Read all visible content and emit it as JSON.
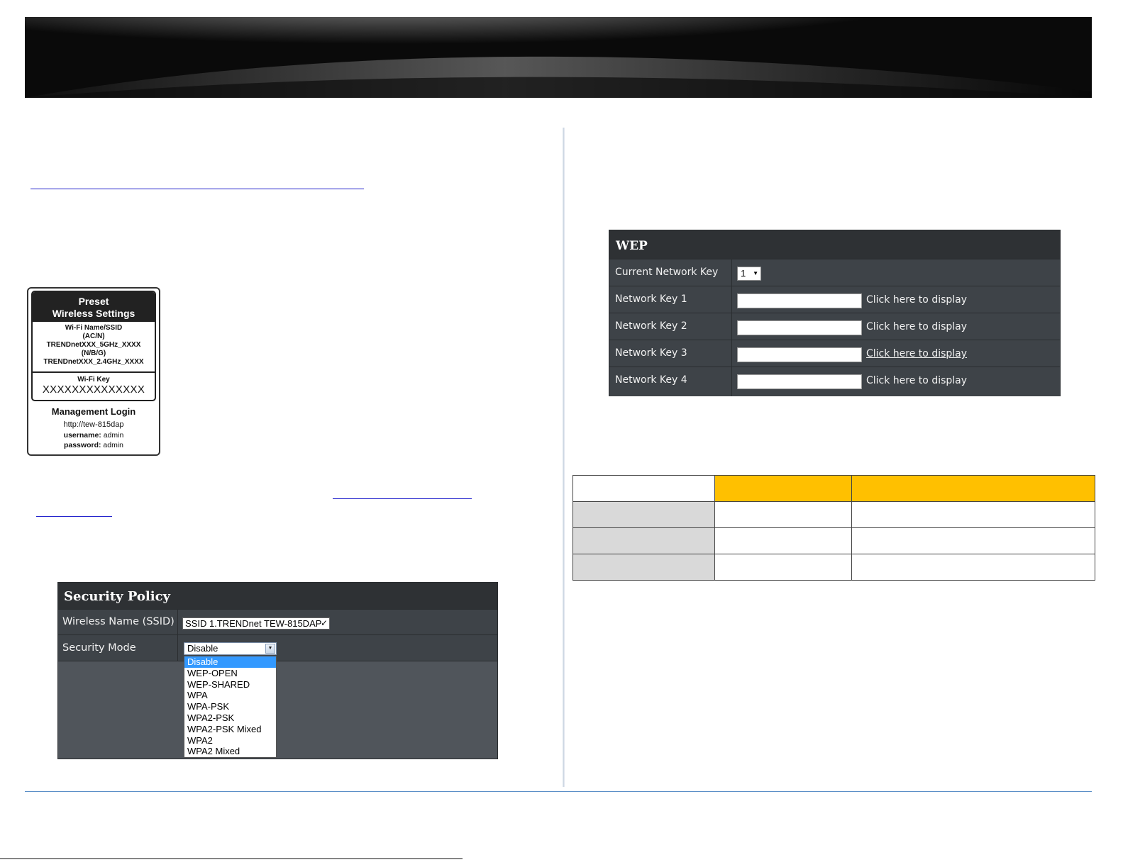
{
  "security_policy": {
    "title": "Security Policy",
    "ssid_label": "Wireless Name (SSID)",
    "ssid_value": "SSID 1.TRENDnet TEW-815DAP",
    "mode_label": "Security Mode",
    "mode_value": "Disable",
    "mode_options": [
      "Disable",
      "WEP-OPEN",
      "WEP-SHARED",
      "WPA",
      "WPA-PSK",
      "WPA2-PSK",
      "WPA2-PSK Mixed",
      "WPA2",
      "WPA2 Mixed"
    ],
    "mode_selected_index": 0
  },
  "wep": {
    "title": "WEP",
    "current_key_label": "Current Network Key",
    "current_key_value": "1",
    "keys": [
      {
        "label": "Network Key 1",
        "link": "Click here to display"
      },
      {
        "label": "Network Key 2",
        "link": "Click here to display"
      },
      {
        "label": "Network Key 3",
        "link": "Click here to display"
      },
      {
        "label": "Network Key 4",
        "link": "Click here to display"
      }
    ]
  },
  "device_label": {
    "header_line1": "Preset",
    "header_line2": "Wireless Settings",
    "ssid_title": "Wi-Fi Name/SSID",
    "ssid_band_ac": "(AC/N)",
    "ssid_5ghz": "TRENDnetXXX_5GHz_XXXX",
    "ssid_band_ng": "(N/B/G)",
    "ssid_24ghz": "TRENDnetXXX_2.4GHz_XXXX",
    "key_title": "Wi-Fi Key",
    "key_value": "XXXXXXXXXXXXXX",
    "mgmt_title": "Management Login",
    "mgmt_url": "http://tew-815dap",
    "username_label": "username:",
    "username_value": "admin",
    "password_label": "password:",
    "password_value": "admin"
  },
  "colors": {
    "panel_bg": "#444a50",
    "table_header_accent": "#ffc000",
    "table_row_label": "#d9d9d9",
    "footer_rule": "#5b8fc7"
  }
}
